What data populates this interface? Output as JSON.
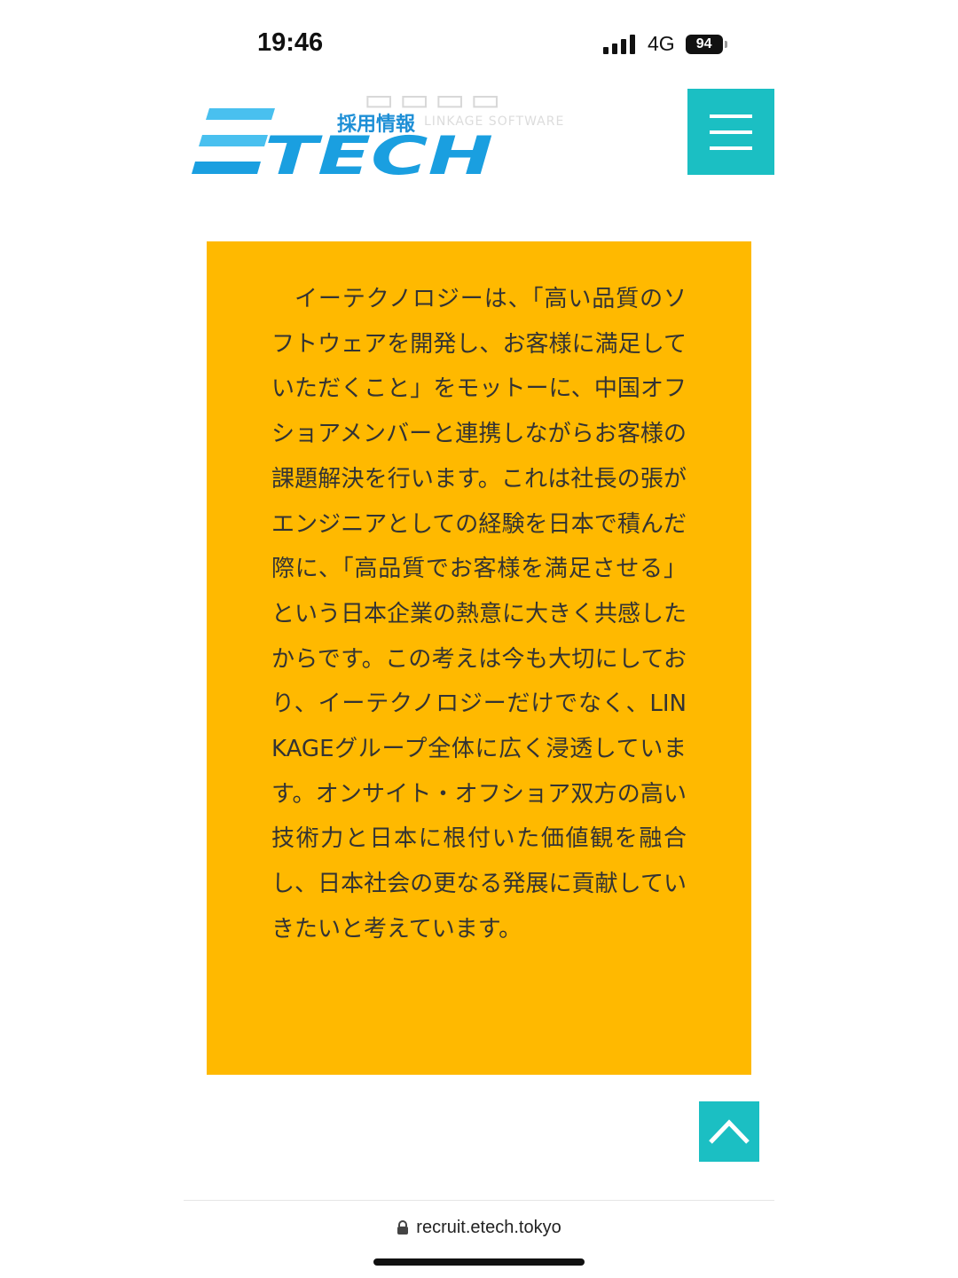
{
  "status_bar": {
    "time": "19:46",
    "network": "4G",
    "battery": "94",
    "icons": [
      "signal-icon",
      "battery-icon"
    ]
  },
  "header": {
    "logo_text": "ETECH",
    "recruit_label": "採用情報",
    "watermark_text": "LINKAGE SOFTWARE",
    "menu_icon": "hamburger-icon",
    "colors": {
      "logo_blue": "#1a9fe0",
      "logo_light": "#49c0ef",
      "accent_teal": "#1bbfc3"
    }
  },
  "intro": {
    "background": "#ffb900",
    "text": "イーテクノロジーは、「高い品質のソフトウェアを開発し、お客様に満足していただくこと」をモットーに、中国オフショアメンバーと連携しながらお客様の課題解決を行います。これは社長の張がエンジニアとしての経験を日本で積んだ際に、「高品質でお客様を満足させる」という日本企業の熱意に大きく共感したからです。この考えは今も大切にしており、イーテクノロジーだけでなく、LINKAGEグループ全体に広く浸透しています。オンサイト・オフショア双方の高い技術力と日本に根付いた価値観を融合し、日本社会の更なる発展に貢献していきたいと考えています。"
  },
  "back_to_top": {
    "icon": "chevron-up-icon"
  },
  "browser": {
    "url": "recruit.etech.tokyo",
    "icon": "lock-icon"
  }
}
